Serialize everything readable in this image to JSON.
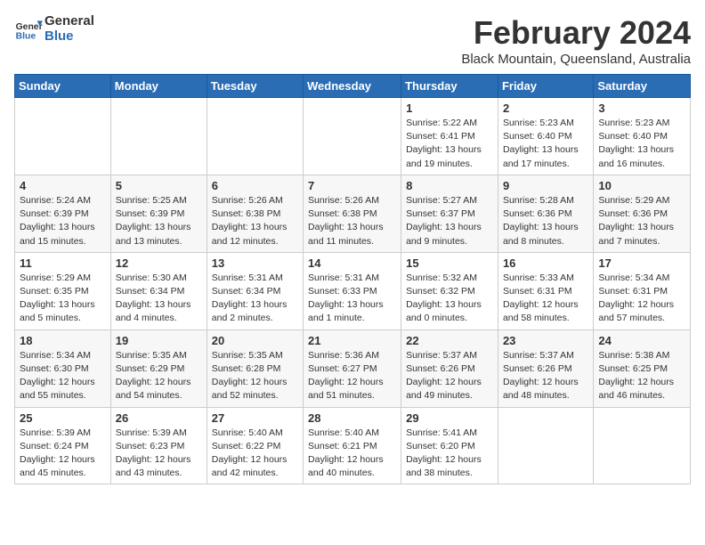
{
  "header": {
    "logo_general": "General",
    "logo_blue": "Blue",
    "month_title": "February 2024",
    "location": "Black Mountain, Queensland, Australia"
  },
  "days_of_week": [
    "Sunday",
    "Monday",
    "Tuesday",
    "Wednesday",
    "Thursday",
    "Friday",
    "Saturday"
  ],
  "weeks": [
    [
      {
        "day": "",
        "info": ""
      },
      {
        "day": "",
        "info": ""
      },
      {
        "day": "",
        "info": ""
      },
      {
        "day": "",
        "info": ""
      },
      {
        "day": "1",
        "info": "Sunrise: 5:22 AM\nSunset: 6:41 PM\nDaylight: 13 hours\nand 19 minutes."
      },
      {
        "day": "2",
        "info": "Sunrise: 5:23 AM\nSunset: 6:40 PM\nDaylight: 13 hours\nand 17 minutes."
      },
      {
        "day": "3",
        "info": "Sunrise: 5:23 AM\nSunset: 6:40 PM\nDaylight: 13 hours\nand 16 minutes."
      }
    ],
    [
      {
        "day": "4",
        "info": "Sunrise: 5:24 AM\nSunset: 6:39 PM\nDaylight: 13 hours\nand 15 minutes."
      },
      {
        "day": "5",
        "info": "Sunrise: 5:25 AM\nSunset: 6:39 PM\nDaylight: 13 hours\nand 13 minutes."
      },
      {
        "day": "6",
        "info": "Sunrise: 5:26 AM\nSunset: 6:38 PM\nDaylight: 13 hours\nand 12 minutes."
      },
      {
        "day": "7",
        "info": "Sunrise: 5:26 AM\nSunset: 6:38 PM\nDaylight: 13 hours\nand 11 minutes."
      },
      {
        "day": "8",
        "info": "Sunrise: 5:27 AM\nSunset: 6:37 PM\nDaylight: 13 hours\nand 9 minutes."
      },
      {
        "day": "9",
        "info": "Sunrise: 5:28 AM\nSunset: 6:36 PM\nDaylight: 13 hours\nand 8 minutes."
      },
      {
        "day": "10",
        "info": "Sunrise: 5:29 AM\nSunset: 6:36 PM\nDaylight: 13 hours\nand 7 minutes."
      }
    ],
    [
      {
        "day": "11",
        "info": "Sunrise: 5:29 AM\nSunset: 6:35 PM\nDaylight: 13 hours\nand 5 minutes."
      },
      {
        "day": "12",
        "info": "Sunrise: 5:30 AM\nSunset: 6:34 PM\nDaylight: 13 hours\nand 4 minutes."
      },
      {
        "day": "13",
        "info": "Sunrise: 5:31 AM\nSunset: 6:34 PM\nDaylight: 13 hours\nand 2 minutes."
      },
      {
        "day": "14",
        "info": "Sunrise: 5:31 AM\nSunset: 6:33 PM\nDaylight: 13 hours\nand 1 minute."
      },
      {
        "day": "15",
        "info": "Sunrise: 5:32 AM\nSunset: 6:32 PM\nDaylight: 13 hours\nand 0 minutes."
      },
      {
        "day": "16",
        "info": "Sunrise: 5:33 AM\nSunset: 6:31 PM\nDaylight: 12 hours\nand 58 minutes."
      },
      {
        "day": "17",
        "info": "Sunrise: 5:34 AM\nSunset: 6:31 PM\nDaylight: 12 hours\nand 57 minutes."
      }
    ],
    [
      {
        "day": "18",
        "info": "Sunrise: 5:34 AM\nSunset: 6:30 PM\nDaylight: 12 hours\nand 55 minutes."
      },
      {
        "day": "19",
        "info": "Sunrise: 5:35 AM\nSunset: 6:29 PM\nDaylight: 12 hours\nand 54 minutes."
      },
      {
        "day": "20",
        "info": "Sunrise: 5:35 AM\nSunset: 6:28 PM\nDaylight: 12 hours\nand 52 minutes."
      },
      {
        "day": "21",
        "info": "Sunrise: 5:36 AM\nSunset: 6:27 PM\nDaylight: 12 hours\nand 51 minutes."
      },
      {
        "day": "22",
        "info": "Sunrise: 5:37 AM\nSunset: 6:26 PM\nDaylight: 12 hours\nand 49 minutes."
      },
      {
        "day": "23",
        "info": "Sunrise: 5:37 AM\nSunset: 6:26 PM\nDaylight: 12 hours\nand 48 minutes."
      },
      {
        "day": "24",
        "info": "Sunrise: 5:38 AM\nSunset: 6:25 PM\nDaylight: 12 hours\nand 46 minutes."
      }
    ],
    [
      {
        "day": "25",
        "info": "Sunrise: 5:39 AM\nSunset: 6:24 PM\nDaylight: 12 hours\nand 45 minutes."
      },
      {
        "day": "26",
        "info": "Sunrise: 5:39 AM\nSunset: 6:23 PM\nDaylight: 12 hours\nand 43 minutes."
      },
      {
        "day": "27",
        "info": "Sunrise: 5:40 AM\nSunset: 6:22 PM\nDaylight: 12 hours\nand 42 minutes."
      },
      {
        "day": "28",
        "info": "Sunrise: 5:40 AM\nSunset: 6:21 PM\nDaylight: 12 hours\nand 40 minutes."
      },
      {
        "day": "29",
        "info": "Sunrise: 5:41 AM\nSunset: 6:20 PM\nDaylight: 12 hours\nand 38 minutes."
      },
      {
        "day": "",
        "info": ""
      },
      {
        "day": "",
        "info": ""
      }
    ]
  ]
}
